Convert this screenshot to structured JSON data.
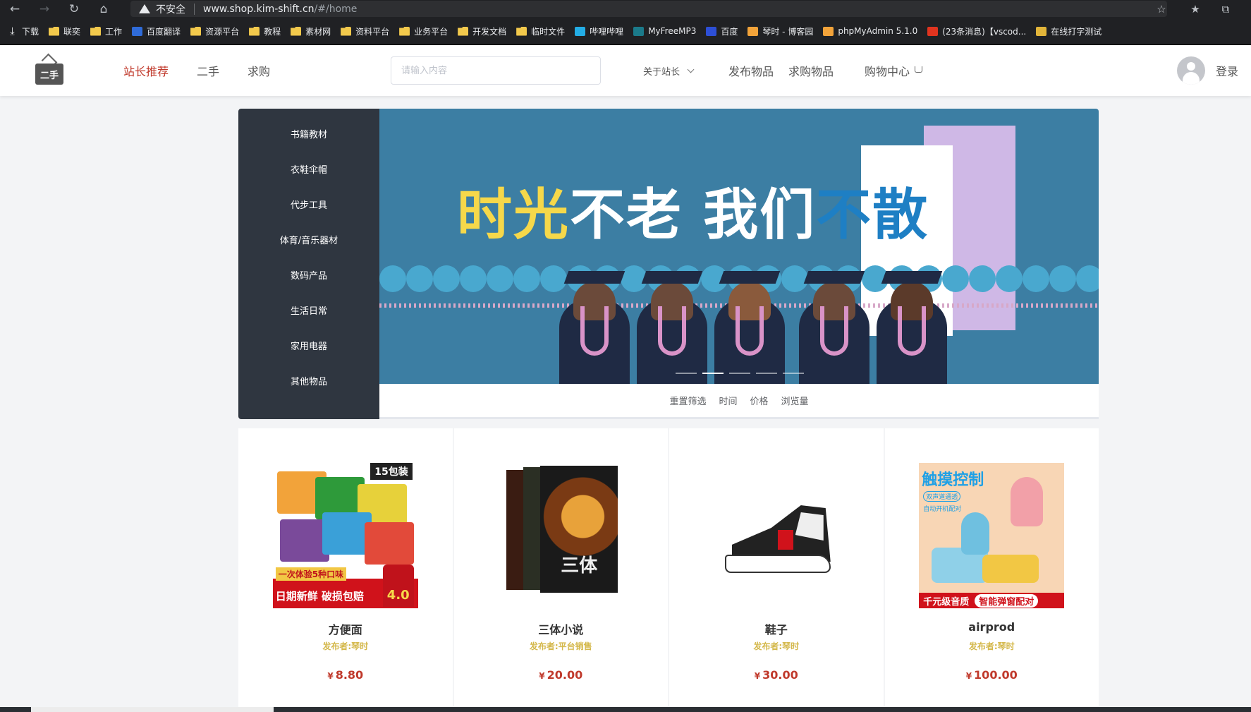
{
  "browser": {
    "insecure_label": "不安全",
    "url_host": "www.shop.kim-shift.cn",
    "url_path": "/#/home",
    "bookmarks": [
      {
        "label": "下载",
        "icon": "download-icon"
      },
      {
        "label": "联奕",
        "icon": "folder-icon"
      },
      {
        "label": "工作",
        "icon": "folder-icon"
      },
      {
        "label": "百度翻译",
        "icon": "translate-icon"
      },
      {
        "label": "资源平台",
        "icon": "folder-icon"
      },
      {
        "label": "教程",
        "icon": "folder-icon"
      },
      {
        "label": "素材网",
        "icon": "folder-icon"
      },
      {
        "label": "资料平台",
        "icon": "folder-icon"
      },
      {
        "label": "业务平台",
        "icon": "folder-icon"
      },
      {
        "label": "开发文档",
        "icon": "folder-icon"
      },
      {
        "label": "临时文件",
        "icon": "folder-icon"
      },
      {
        "label": "哔哩哔哩",
        "icon": "bilibili-icon"
      },
      {
        "label": "MyFreeMP3",
        "icon": "music-icon"
      },
      {
        "label": "百度",
        "icon": "baidu-icon"
      },
      {
        "label": "琴时 - 博客园",
        "icon": "blog-icon"
      },
      {
        "label": "phpMyAdmin 5.1.0",
        "icon": "phpmyadmin-icon"
      },
      {
        "label": "(23条消息)【vscod...",
        "icon": "csdn-icon"
      },
      {
        "label": "在线打字测试",
        "icon": "typing-icon"
      }
    ]
  },
  "header": {
    "logo_text": "二手",
    "nav": {
      "recommend": "站长推荐",
      "secondhand": "二手",
      "wanted": "求购"
    },
    "search_placeholder": "请输入内容",
    "about": "关于站长",
    "publish": "发布物品",
    "request": "求购物品",
    "cart": "购物中心",
    "login": "登录"
  },
  "categories": [
    "书籍教材",
    "衣鞋伞帽",
    "代步工具",
    "体育/音乐器材",
    "数码产品",
    "生活日常",
    "家用电器",
    "其他物品"
  ],
  "banner": {
    "title_part1": "时光",
    "title_part2": "不老 我们",
    "title_part3": "不散"
  },
  "filters": [
    "重置筛选",
    "时间",
    "价格",
    "浏览量"
  ],
  "products": [
    {
      "name": "方便面",
      "seller": "发布者:琴时",
      "currency": "¥",
      "price": "8.80",
      "art": {
        "badge": "15包装",
        "tag_top": "一次体验5种口味",
        "tag_bottom": "日期新鲜 破损包赔",
        "tag_price": "4.0"
      }
    },
    {
      "name": "三体小说",
      "seller": "发布者:平台销售",
      "currency": "¥",
      "price": "20.00",
      "art": {
        "cover_text": "三体"
      }
    },
    {
      "name": "鞋子",
      "seller": "发布者:琴时",
      "currency": "¥",
      "price": "30.00",
      "art": {}
    },
    {
      "name": "airprod",
      "seller": "发布者:琴时",
      "currency": "¥",
      "price": "100.00",
      "art": {
        "headline": "触摸控制",
        "sub1": "双声道通透",
        "sub2": "自动开机配对",
        "foot1": "千元级音质",
        "foot2": "智能弹窗配对"
      }
    }
  ],
  "colors": {
    "accent_red": "#c0392b",
    "sidebar_bg": "#2f3640",
    "banner_bg": "#3c7ea3",
    "seller_gold": "#d4b84b"
  }
}
